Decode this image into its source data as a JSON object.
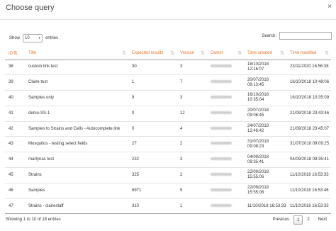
{
  "modal": {
    "title": "Choose query",
    "close_glyph": "×"
  },
  "controls": {
    "show_label": "Show",
    "entries_value": "10",
    "entries_label": "entries",
    "search_label": "Search:",
    "search_value": ""
  },
  "columns": {
    "id": "ID",
    "title": "Title",
    "expected": "Expected results",
    "version": "Version",
    "owner": "Owner",
    "created": "Time created",
    "modified": "Time modified"
  },
  "rows": [
    {
      "id": "38",
      "title": "custom link test",
      "expected": "30",
      "version": "3",
      "created": "18/10/2018 12:16:07",
      "modified": "23/11/2020 16:56:38"
    },
    {
      "id": "39",
      "title": "Claire test",
      "expected": "1",
      "version": "7",
      "created": "20/07/2018 08:13:45",
      "modified": "16/10/2018 10:48:06"
    },
    {
      "id": "40",
      "title": "Samples only",
      "expected": "9",
      "version": "3",
      "created": "16/10/2018 10:35:04",
      "modified": "16/10/2018 10:35:09"
    },
    {
      "id": "41",
      "title": "demo-SS-1",
      "expected": "0",
      "version": "12",
      "created": "20/07/2018 09:06:45",
      "modified": "21/09/2018 23:43:46"
    },
    {
      "id": "42",
      "title": "Samples to Strains and Cells - Autocomplete link",
      "expected": "0",
      "version": "4",
      "created": "24/07/2018 12:46:42",
      "modified": "21/09/2018 23:45:07"
    },
    {
      "id": "43",
      "title": "Mosquitos - testing select fields",
      "expected": "27",
      "version": "2",
      "created": "31/07/2018 09:08:23",
      "modified": "31/07/2018 09:09:25"
    },
    {
      "id": "44",
      "title": "martynas test",
      "expected": "232",
      "version": "3",
      "created": "04/09/2018 09:35:41",
      "modified": "04/09/2018 09:35:41"
    },
    {
      "id": "45",
      "title": "Strains",
      "expected": "325",
      "version": "2",
      "created": "22/09/2018 15:55:06",
      "modified": "11/10/2018 16:53:33"
    },
    {
      "id": "46",
      "title": "Samples",
      "expected": "6971",
      "version": "5",
      "created": "22/09/2018 15:55:06",
      "modified": "11/10/2018 16:53:46"
    },
    {
      "id": "47",
      "title": "Strains - clairestaff",
      "expected": "310",
      "version": "1",
      "created": "11/10/2018 16:53:33",
      "modified": "11/10/2018 16:53:33"
    }
  ],
  "footer": {
    "info": "Showing 1 to 10 of 18 entries",
    "previous": "Previous",
    "current_page": "1",
    "page_2": "2",
    "next": "Next"
  },
  "colors": {
    "accent": "#e8762b",
    "border": "#999999"
  },
  "icons": {
    "sort": "sort-arrows-icon",
    "sort_active": "sort-ascending-icon",
    "close": "close-icon"
  }
}
